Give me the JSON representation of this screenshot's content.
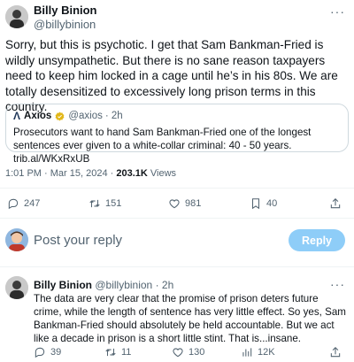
{
  "tweet": {
    "author_name": "Billy Binion",
    "author_handle": "@billybinion",
    "more_icon": "more-dots-icon",
    "text": "Sorry, but this is psychotic. I get that Sam Bankman-Fried is wildly unsympathetic. But there is no sane reason taxpayers need to keep him locked in a cage until he’s in his 80s. We are totally desensitized to excessively long prison terms in this country.",
    "quote": {
      "logo": "Λ",
      "name": "Axios",
      "handle": "@axios",
      "time": "· 2h",
      "text": "Prosecutors want to hand Sam Bankman-Fried one of the longest sentences ever given to a white-collar criminal: 40 - 50 years. trib.al/WKxRxUB"
    },
    "timestamp": "1:01 PM · Mar 15, 2024 · ",
    "views_count": "203.1K",
    "views_label": " Views",
    "stats": {
      "replies": "247",
      "reposts": "151",
      "likes": "981",
      "bookmarks": "40"
    }
  },
  "reply_box": {
    "placeholder": "Post your reply",
    "button_label": "Reply"
  },
  "reply": {
    "author_name": "Billy Binion",
    "author_handle": "@billybinion",
    "time": "· 2h",
    "text": "The data are very clear that the promise of prison deters future crime, while the length of sentence has very little effect. So yes, Sam Bankman-Fried should absolutely be held accountable. But we act like a decade in prison is a short little stint. That is...insane.",
    "stats": {
      "replies": "39",
      "reposts": "11",
      "likes": "130",
      "views": "12K"
    }
  },
  "colors": {
    "text": "#0f1419",
    "muted": "#536471",
    "reply_button": "#8ecdf8",
    "verified": "#e2b719"
  }
}
